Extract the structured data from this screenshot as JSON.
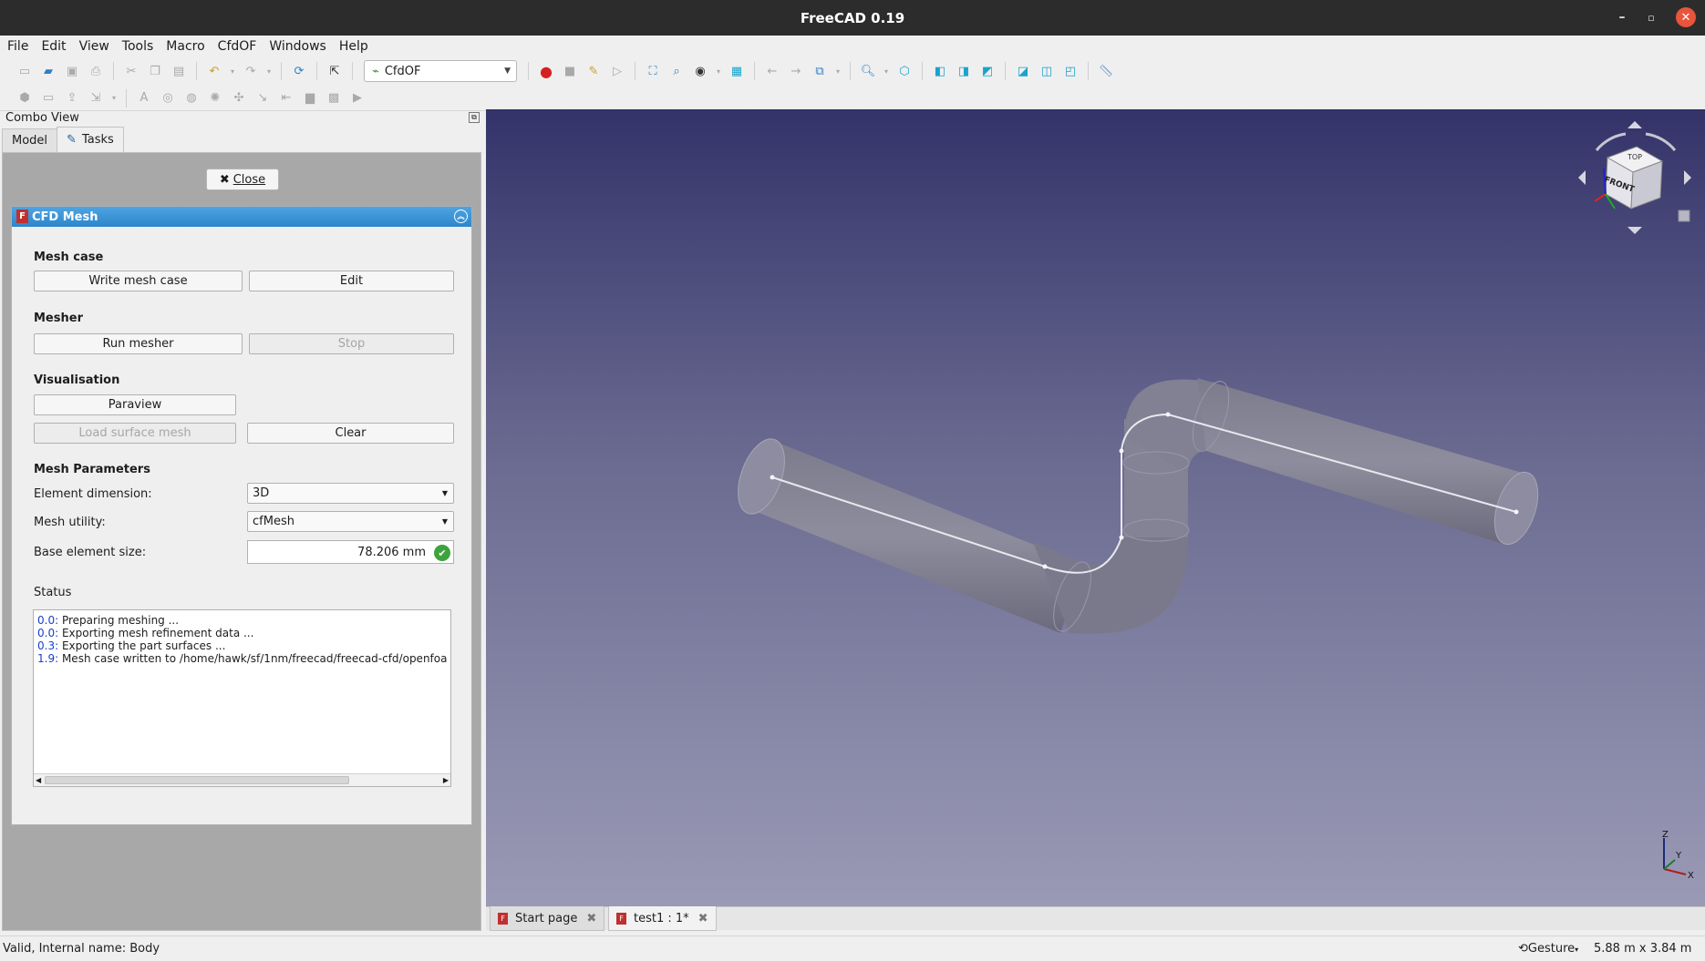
{
  "window": {
    "title": "FreeCAD 0.19",
    "min": "–",
    "max": "▫",
    "close": "✕"
  },
  "menu": [
    "File",
    "Edit",
    "View",
    "Tools",
    "Macro",
    "CfdOF",
    "Windows",
    "Help"
  ],
  "toolbar": {
    "workbench": "CfdOF",
    "icons": [
      "new-icon",
      "open-icon",
      "save-icon",
      "print-icon",
      "cut-icon",
      "copy-icon",
      "paste-icon",
      "undo-icon",
      "redo-icon",
      "refresh-icon",
      "whats-this-icon",
      "record-macro-icon",
      "stop-macro-icon",
      "edit-macro-icon",
      "run-macro-icon",
      "fit-all-icon",
      "fit-selection-icon",
      "draw-style-icon",
      "bounding-box-icon",
      "back-icon",
      "forward-icon",
      "sync-view-icon",
      "zoom-icon",
      "view-iso-icon",
      "view-front-icon",
      "view-top-icon",
      "view-right-icon",
      "view-rear-icon",
      "view-bottom-icon",
      "view-left-icon",
      "measure-icon"
    ]
  },
  "combo_view": {
    "title": "Combo View",
    "tabs": [
      "Model",
      "Tasks"
    ],
    "active_tab": "Tasks",
    "close_label": "Close"
  },
  "cfd_mesh": {
    "header": "CFD Mesh",
    "mesh_case": {
      "title": "Mesh case",
      "write": "Write mesh case",
      "edit": "Edit"
    },
    "mesher": {
      "title": "Mesher",
      "run": "Run mesher",
      "stop": "Stop"
    },
    "visualisation": {
      "title": "Visualisation",
      "paraview": "Paraview",
      "load": "Load surface mesh",
      "clear": "Clear"
    },
    "params": {
      "title": "Mesh Parameters",
      "element_dimension_label": "Element dimension:",
      "element_dimension": "3D",
      "mesh_utility_label": "Mesh utility:",
      "mesh_utility": "cfMesh",
      "base_size_label": "Base element size:",
      "base_size": "78.206 mm"
    },
    "status": {
      "title": "Status",
      "lines": [
        {
          "time": "0.0:",
          "text": " Preparing meshing ..."
        },
        {
          "time": "0.0:",
          "text": " Exporting mesh refinement data ..."
        },
        {
          "time": "0.3:",
          "text": " Exporting the part surfaces ..."
        },
        {
          "time": "1.9:",
          "text": " Mesh case written to /home/hawk/sf/1nm/freecad/freecad-cfd/openfoa"
        }
      ]
    }
  },
  "navcube": {
    "top": "TOP",
    "front": "FRONT"
  },
  "axes": {
    "x": "X",
    "y": "Y",
    "z": "Z"
  },
  "doc_tabs": [
    {
      "label": "Start page",
      "active": false
    },
    {
      "label": "test1 : 1*",
      "active": true
    }
  ],
  "statusbar": {
    "message": "Valid, Internal name: Body",
    "nav_style": "Gesture",
    "dimensions": "5.88 m x 3.84 m"
  },
  "colors": {
    "header_blue": "#2c86cc",
    "view_top": "#33336a",
    "view_bottom": "#9a9ab6",
    "time_blue": "#1a3fcc"
  }
}
